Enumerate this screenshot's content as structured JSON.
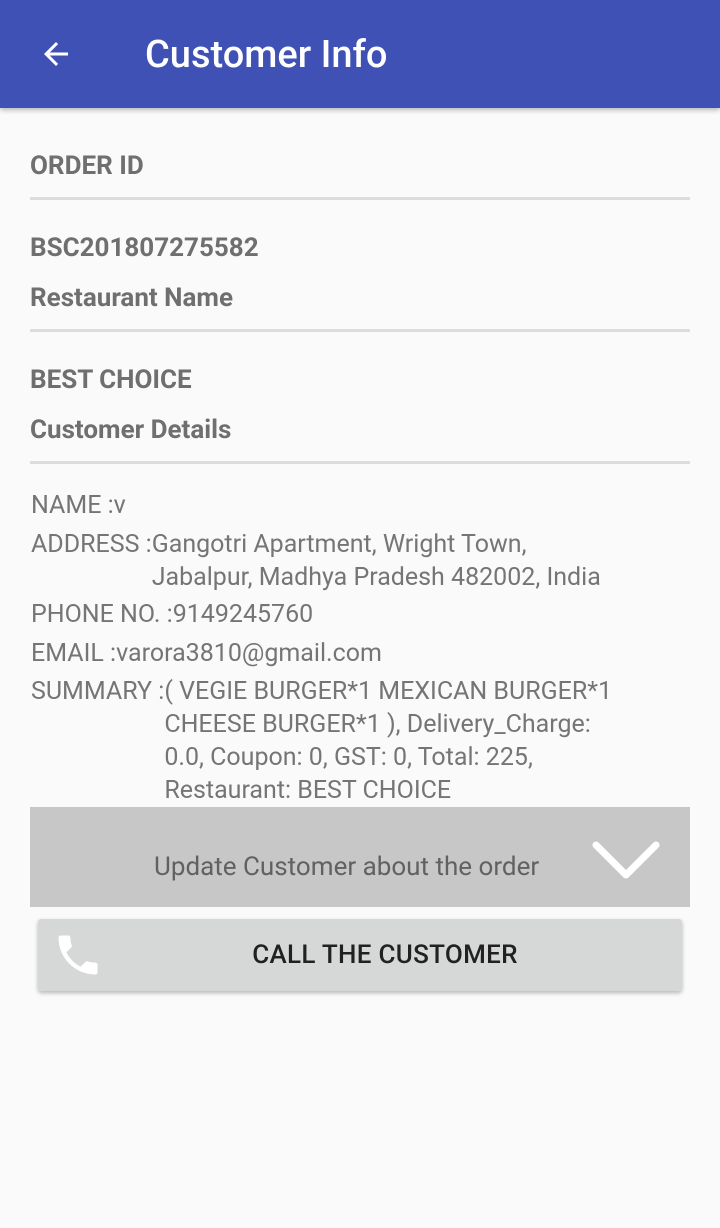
{
  "appbar": {
    "title": "Customer Info",
    "back_icon": "arrow-back-icon",
    "color": "#3f51b5"
  },
  "order": {
    "id_label": "ORDER ID",
    "id_value": "BSC201807275582",
    "restaurant_label": "Restaurant Name",
    "restaurant_value": "BEST CHOICE",
    "customer_label": "Customer Details"
  },
  "customer": {
    "name_key": "NAME :",
    "name_val": "v",
    "address_key": "ADDRESS :",
    "address_line1": "Gangotri Apartment, Wright Town,",
    "address_line2": "Jabalpur, Madhya Pradesh 482002, India",
    "phone_key": "PHONE NO. :",
    "phone_val": "9149245760",
    "email_key": "EMAIL :",
    "email_val": "varora3810@gmail.com",
    "summary_key": "SUMMARY :",
    "summary_line1": "( VEGIE BURGER*1 MEXICAN BURGER*1",
    "summary_line2": "CHEESE BURGER*1  ), Delivery_Charge:",
    "summary_line3": "0.0, Coupon: 0, GST: 0, Total: 225,",
    "summary_line4": "Restaurant: BEST CHOICE"
  },
  "update_dropdown": {
    "label": "Update Customer about the order",
    "icon": "chevron-down-icon"
  },
  "call_button": {
    "label": "CALL THE CUSTOMER",
    "icon": "phone-icon"
  }
}
